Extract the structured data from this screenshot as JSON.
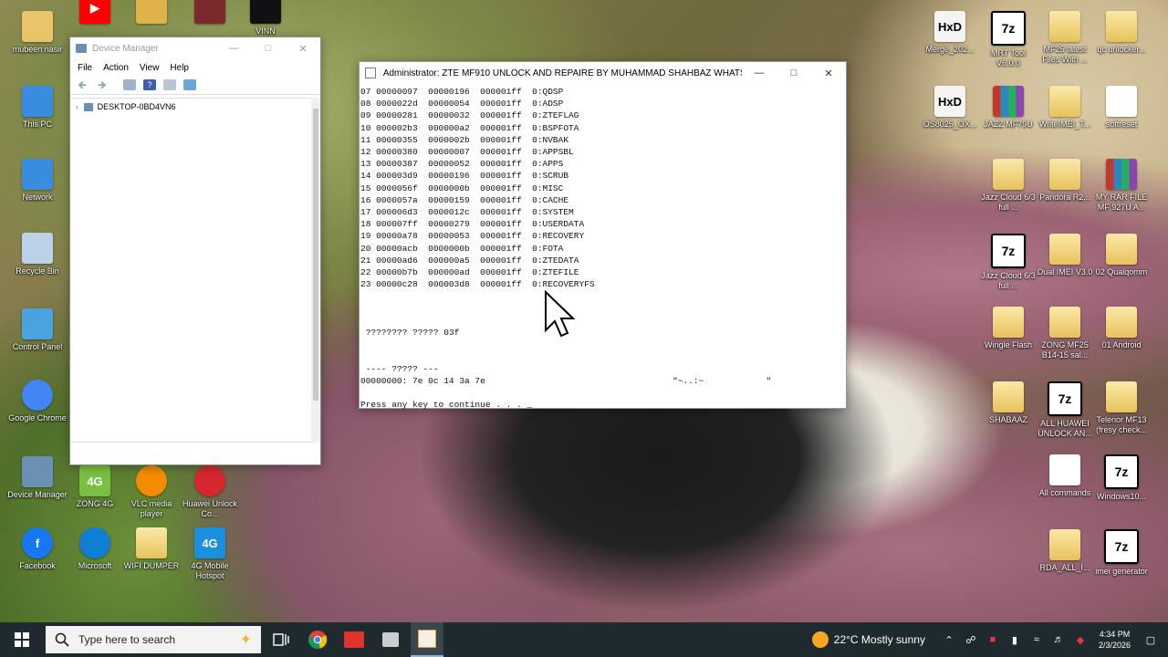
{
  "desktop_icons_left": [
    {
      "label": "mubeen nasir",
      "kind": "user",
      "color": "#e9c46a"
    },
    {
      "label": "This PC",
      "kind": "pc",
      "color": "#3a8dde"
    },
    {
      "label": "Network",
      "kind": "network",
      "color": "#3a8dde"
    },
    {
      "label": "Recycle Bin",
      "kind": "recycle",
      "color": "#bcd2e8"
    },
    {
      "label": "Control Panel",
      "kind": "control",
      "color": "#4aa3df"
    },
    {
      "label": "Google Chrome",
      "kind": "chrome",
      "color": "#4285f4"
    },
    {
      "label": "Device Manager",
      "kind": "devmgr",
      "color": "#6c8fb4"
    },
    {
      "label": "Facebook",
      "kind": "facebook",
      "color": "#1877f2"
    }
  ],
  "desktop_icons_bottom": [
    {
      "label": "ZONG 4G",
      "kind": "zong",
      "color": "#7ac143"
    },
    {
      "label": "VLC media player",
      "kind": "vlc",
      "color": "#f48b00"
    },
    {
      "label": "Huawei Unlock Co...",
      "kind": "huawei",
      "color": "#d7262e"
    },
    {
      "label": "Microsoft",
      "kind": "edge",
      "color": "#0f7fd6"
    },
    {
      "label": "WIFI DUMPER",
      "kind": "folder",
      "color": "#e8c25c"
    },
    {
      "label": "4G Mobile Hotspot",
      "kind": "4g",
      "color": "#1b8fe0"
    }
  ],
  "desktop_icons_top": [
    {
      "label": "",
      "kind": "youtube",
      "color": "#ff0000"
    },
    {
      "label": "",
      "kind": "app",
      "color": "#e0b24a"
    },
    {
      "label": "",
      "kind": "app",
      "color": "#7a2a2a"
    },
    {
      "label": "VINN",
      "kind": "vinn",
      "color": "#111111"
    }
  ],
  "desktop_icons_right": [
    {
      "label": "Merge_202...",
      "kind": "hxd"
    },
    {
      "label": "MRT Tool V6.0.0",
      "kind": "7z"
    },
    {
      "label": "MF25 latest Files With ...",
      "kind": "folder"
    },
    {
      "label": "qc unlocker...",
      "kind": "folder"
    },
    {
      "label": "OS8025_OX...",
      "kind": "hxd"
    },
    {
      "label": "JAZZ MF79U",
      "kind": "rar"
    },
    {
      "label": "WriteIMEI_T...",
      "kind": "folder"
    },
    {
      "label": "softreset",
      "kind": "doc"
    },
    {
      "label": "Jazz Cloud 6/3 full ...",
      "kind": "folder"
    },
    {
      "label": "Pandora R2...",
      "kind": "folder"
    },
    {
      "label": "MY RAR FILE MF 927U A...",
      "kind": "rar"
    },
    {
      "label": "Jazz Cloud 6/3 full ...",
      "kind": "7z"
    },
    {
      "label": "Dual IMEI V3.0",
      "kind": "folder"
    },
    {
      "label": "02 Qualqomm",
      "kind": "folder"
    },
    {
      "label": "Wingle Flash",
      "kind": "folder"
    },
    {
      "label": "ZONG MF25 B14-15 sal...",
      "kind": "folder"
    },
    {
      "label": "01 Android",
      "kind": "folder"
    },
    {
      "label": "SHABAAZ",
      "kind": "folder"
    },
    {
      "label": "ALL HUAWEI UNLOCK AN...",
      "kind": "7z"
    },
    {
      "label": "Telenor MF13 (fresy check...",
      "kind": "folder"
    },
    {
      "label": "All commands",
      "kind": "doc"
    },
    {
      "label": "Windows10...",
      "kind": "7z"
    },
    {
      "label": "RDA_ALL_I...",
      "kind": "folder"
    },
    {
      "label": "imei generator",
      "kind": "7z"
    }
  ],
  "device_manager": {
    "title": "Device Manager",
    "menu": [
      "File",
      "Action",
      "View",
      "Help"
    ],
    "tree_root": "DESKTOP-0BD4VN6"
  },
  "console": {
    "title": "Administrator:  ZTE MF910 UNLOCK AND REPAIRE BY MUHAMMAD SHAHBAZ WHATSA...",
    "partitions": [
      {
        "idx": "07",
        "start": "00000097",
        "size": "00000196",
        "attr": "000001ff",
        "name": "0:QDSP"
      },
      {
        "idx": "08",
        "start": "0000022d",
        "size": "00000054",
        "attr": "000001ff",
        "name": "0:ADSP"
      },
      {
        "idx": "09",
        "start": "00000281",
        "size": "00000032",
        "attr": "000001ff",
        "name": "0:ZTEFLAG"
      },
      {
        "idx": "10",
        "start": "000002b3",
        "size": "000000a2",
        "attr": "000001ff",
        "name": "0:BSPFOTA"
      },
      {
        "idx": "11",
        "start": "00000355",
        "size": "0000002b",
        "attr": "000001ff",
        "name": "0:NVBAK"
      },
      {
        "idx": "12",
        "start": "00000380",
        "size": "00000007",
        "attr": "000001ff",
        "name": "0:APPSBL"
      },
      {
        "idx": "13",
        "start": "00000387",
        "size": "00000052",
        "attr": "000001ff",
        "name": "0:APPS"
      },
      {
        "idx": "14",
        "start": "000003d9",
        "size": "00000196",
        "attr": "000001ff",
        "name": "0:SCRUB"
      },
      {
        "idx": "15",
        "start": "0000056f",
        "size": "0000000b",
        "attr": "000001ff",
        "name": "0:MISC"
      },
      {
        "idx": "16",
        "start": "0000057a",
        "size": "00000159",
        "attr": "000001ff",
        "name": "0:CACHE"
      },
      {
        "idx": "17",
        "start": "000006d3",
        "size": "0000012c",
        "attr": "000001ff",
        "name": "0:SYSTEM"
      },
      {
        "idx": "18",
        "start": "000007ff",
        "size": "00000279",
        "attr": "000001ff",
        "name": "0:USERDATA"
      },
      {
        "idx": "19",
        "start": "00000a78",
        "size": "00000053",
        "attr": "000001ff",
        "name": "0:RECOVERY"
      },
      {
        "idx": "20",
        "start": "00000acb",
        "size": "0000000b",
        "attr": "000001ff",
        "name": "0:FOTA"
      },
      {
        "idx": "21",
        "start": "00000ad6",
        "size": "000000a5",
        "attr": "000001ff",
        "name": "0:ZTEDATA"
      },
      {
        "idx": "22",
        "start": "00000b7b",
        "size": "000000ad",
        "attr": "000001ff",
        "name": "0:ZTEFILE"
      },
      {
        "idx": "23",
        "start": "00000c28",
        "size": "000003d8",
        "attr": "000001ff",
        "name": "0:RECOVERYFS"
      }
    ],
    "status_line": "???????? ????? 03f",
    "dump_header": "---- ????? ---",
    "dump_line": "00000000: 7e 0c 14 3a 7e",
    "dump_ascii": "\"~..:~",
    "dump_tail": "\"",
    "prompt": "Press any key to continue . . . "
  },
  "taskbar": {
    "search_placeholder": "Type here to search",
    "apps": [
      "task-view",
      "chrome",
      "anydesk",
      "network-tool",
      "unlock-tool"
    ],
    "weather": "22°C  Mostly sunny",
    "time": "4:34 PM",
    "date": "2/3/2026"
  },
  "colors": {
    "taskbar": "#1f2a2e",
    "console_bg": "#ffffff",
    "accent": "#0078d7"
  }
}
